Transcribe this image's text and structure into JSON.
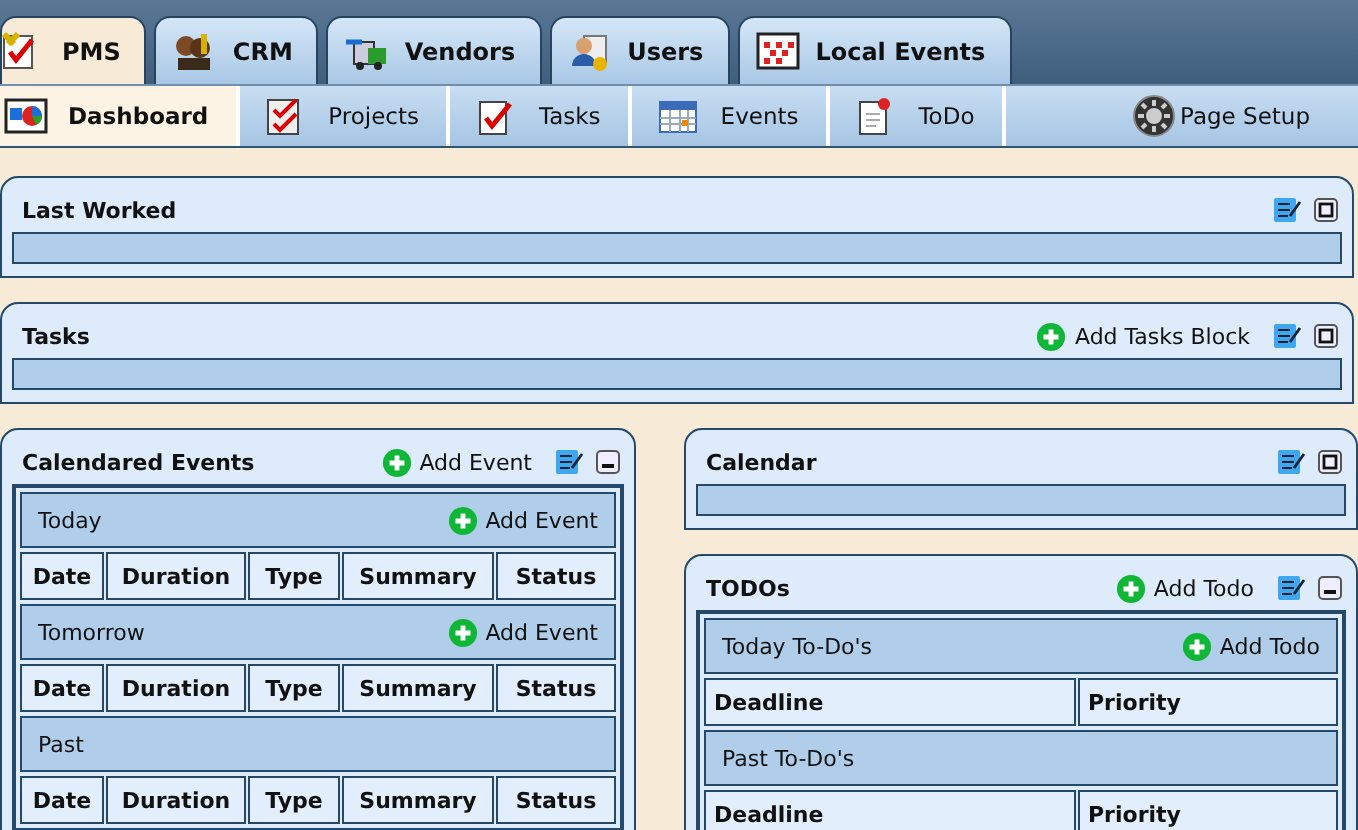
{
  "top_tabs": [
    {
      "label": "PMS",
      "selected": true
    },
    {
      "label": "CRM",
      "selected": false
    },
    {
      "label": "Vendors",
      "selected": false
    },
    {
      "label": "Users",
      "selected": false
    },
    {
      "label": "Local Events",
      "selected": false
    }
  ],
  "sub_tabs": [
    {
      "label": "Dashboard",
      "selected": true
    },
    {
      "label": "Projects",
      "selected": false
    },
    {
      "label": "Tasks",
      "selected": false
    },
    {
      "label": "Events",
      "selected": false
    },
    {
      "label": "ToDo",
      "selected": false
    }
  ],
  "page_setup": "Page Setup",
  "wide_panels": [
    {
      "title": "Last Worked",
      "expanded": false
    },
    {
      "title": "Tasks",
      "add_label": "Add Tasks Block",
      "expanded": false
    }
  ],
  "left_panels": [
    {
      "title": "Calendared Events",
      "add_label": "Add Event",
      "expanded": true,
      "sections": [
        {
          "title": "Today",
          "add_label": "Add Event",
          "columns": [
            "Date",
            "Duration",
            "Type",
            "Summary",
            "Status"
          ]
        },
        {
          "title": "Tomorrow",
          "add_label": "Add Event",
          "columns": [
            "Date",
            "Duration",
            "Type",
            "Summary",
            "Status"
          ]
        },
        {
          "title": "Past",
          "columns": [
            "Date",
            "Duration",
            "Type",
            "Summary",
            "Status"
          ]
        }
      ]
    }
  ],
  "right_panels": [
    {
      "title": "Calendar",
      "expanded": false
    },
    {
      "title": "TODOs",
      "add_label": "Add Todo",
      "expanded": true,
      "sections": [
        {
          "title": "Today To-Do's",
          "add_label": "Add Todo",
          "columns": [
            "Deadline",
            "Priority"
          ]
        },
        {
          "title": "Past To-Do's",
          "columns": [
            "Deadline",
            "Priority"
          ]
        }
      ]
    }
  ]
}
